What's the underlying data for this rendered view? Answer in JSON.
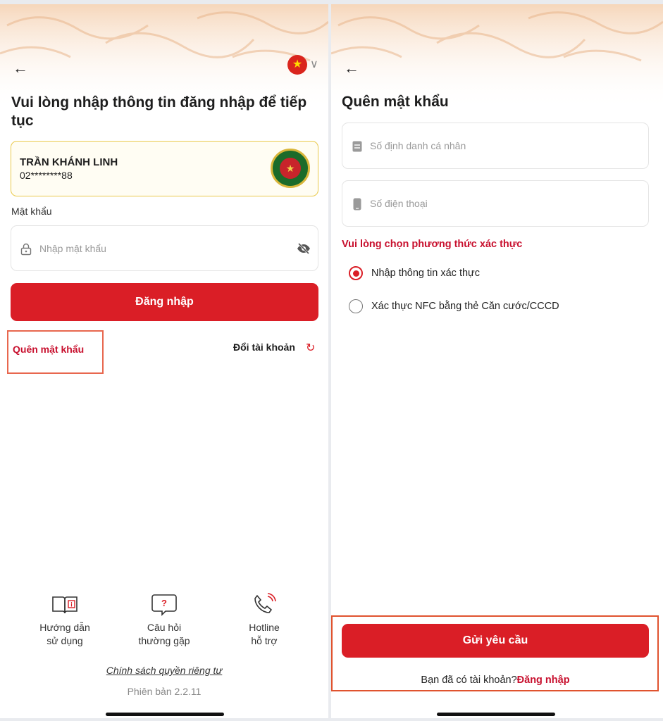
{
  "login": {
    "title": "Vui lòng nhập thông tin đăng nhập để tiếp tục",
    "user_name": "TRẦN KHÁNH LINH",
    "user_id": "02********88",
    "password_label": "Mật khẩu",
    "password_placeholder": "Nhập mật khẩu",
    "login_button": "Đăng nhập",
    "forgot_link": "Quên mật khẩu",
    "switch_account": "Đổi tài khoản",
    "footer": [
      {
        "line1": "Hướng dẫn",
        "line2": "sử dụng",
        "icon": "book-icon"
      },
      {
        "line1": "Câu hỏi",
        "line2": "thường gặp",
        "icon": "question-bubble-icon"
      },
      {
        "line1": "Hotline",
        "line2": "hỗ trợ",
        "icon": "phone-icon"
      }
    ],
    "privacy": "Chính sách quyền riêng tư",
    "version": "Phiên bản 2.2.11"
  },
  "forgot": {
    "title": "Quên mật khẩu",
    "id_placeholder": "Số định danh cá nhân",
    "phone_placeholder": "Số điện thoại",
    "method_title": "Vui lòng chọn phương thức xác thực",
    "options": [
      {
        "label": "Nhập thông tin xác thực",
        "selected": true
      },
      {
        "label": "Xác thực NFC bằng thẻ Căn cước/CCCD",
        "selected": false
      }
    ],
    "send_button": "Gửi yêu cầu",
    "have_account": "Bạn đã có tài khoản?",
    "login_link": "Đăng nhập"
  },
  "colors": {
    "accent": "#da1e26",
    "highlight_border": "#e8674e",
    "card_border": "#e9c94a"
  }
}
